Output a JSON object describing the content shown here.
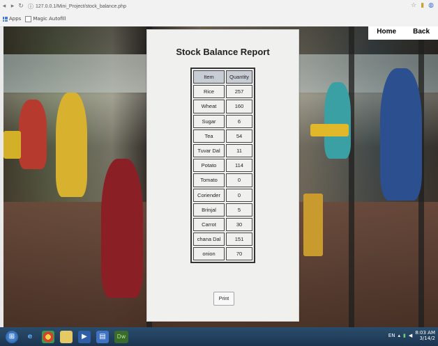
{
  "browser": {
    "url": "127.0.0.1/Mini_Project/stock_balance.php",
    "url_prefix": "ⓘ",
    "bookmarks": [
      {
        "label": "Apps",
        "icon": "apps-grid-icon"
      },
      {
        "label": "Magic Autofill",
        "icon": "page-icon"
      }
    ]
  },
  "site_nav": {
    "home": "Home",
    "back": "Back"
  },
  "report": {
    "title": "Stock Balance Report",
    "columns": [
      "Item",
      "Quantity"
    ],
    "rows": [
      [
        "Rice",
        "257"
      ],
      [
        "Wheat",
        "160"
      ],
      [
        "Sugar",
        "6"
      ],
      [
        "Tea",
        "54"
      ],
      [
        "Tuvar Dal",
        "11"
      ],
      [
        "Potato",
        "114"
      ],
      [
        "Tomato",
        "0"
      ],
      [
        "Coriender",
        "0"
      ],
      [
        "Brinjal",
        "5"
      ],
      [
        "Carrot",
        "30"
      ],
      [
        "chana Dal",
        "151"
      ],
      [
        "onion",
        "70"
      ]
    ],
    "print_label": "Print"
  },
  "taskbar": {
    "tray_lang": "EN",
    "clock_time": "8:03 AM",
    "clock_date": "3/14/2"
  },
  "colors": {
    "card_bg": "#f0f0ee",
    "header_bg": "#c8ccd4",
    "taskbar": "#1b3550"
  }
}
